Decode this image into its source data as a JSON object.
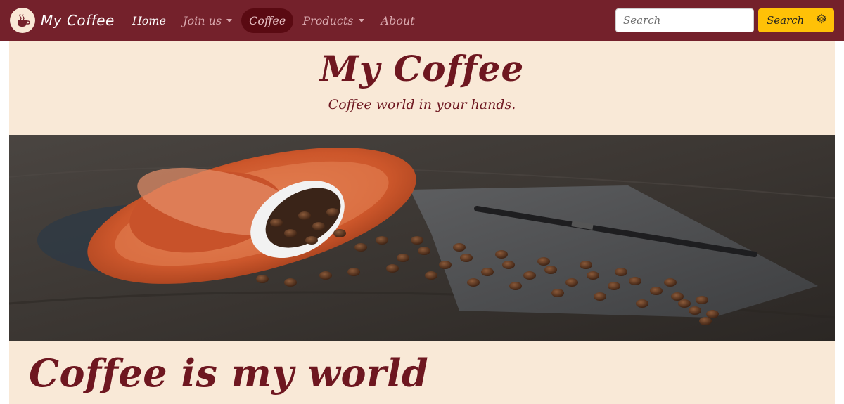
{
  "navbar": {
    "brand": "My Coffee",
    "logo_icon": "coffee-cup-icon",
    "items": [
      {
        "label": "Home",
        "state": "active"
      },
      {
        "label": "Join us",
        "dropdown": true
      },
      {
        "label": "Coffee",
        "state": "highlighted"
      },
      {
        "label": "Products",
        "dropdown": true
      },
      {
        "label": "About"
      }
    ],
    "search": {
      "placeholder": "Search",
      "button_label": "Search",
      "button_icon": "gear-icon"
    }
  },
  "header": {
    "title": "My Coffee",
    "subtitle": "Coffee world in your hands."
  },
  "hero": {
    "image_icon": "coffee-beans-image"
  },
  "section": {
    "title": "Coffee is my world"
  },
  "colors": {
    "navbar_bg": "#74212b",
    "cream_bg": "#f9e9d7",
    "brand_text": "#6e1720",
    "search_button": "#ffc107",
    "highlight_pill": "#5a0a12"
  }
}
